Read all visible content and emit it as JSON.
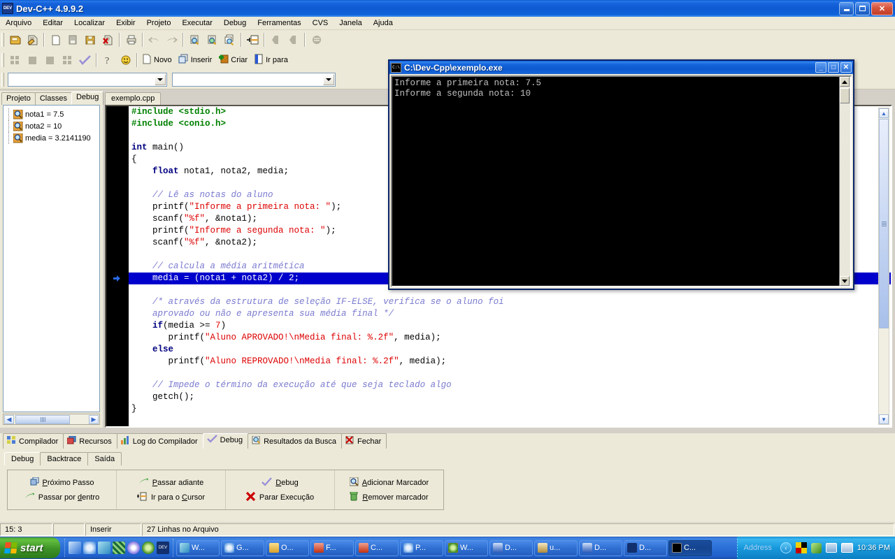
{
  "window": {
    "title": "Dev-C++ 4.9.9.2",
    "icon": "dev-cpp-icon",
    "buttons": {
      "minimize": "minimize-button",
      "restore": "restore-button",
      "close": "close-button"
    }
  },
  "menubar": {
    "items": [
      "Arquivo",
      "Editar",
      "Localizar",
      "Exibir",
      "Projeto",
      "Executar",
      "Debug",
      "Ferramentas",
      "CVS",
      "Janela",
      "Ajuda"
    ]
  },
  "toolbar": {
    "row1_icons": [
      "open-project-icon",
      "open-file-icon",
      "new-file-icon",
      "save-file-icon",
      "save-all-icon",
      "close-file-icon",
      "print-icon",
      "undo-icon",
      "redo-icon",
      "find-icon",
      "find-next-icon",
      "replace-icon",
      "goto-line-icon",
      "back-icon",
      "forward-icon",
      "list-icon"
    ],
    "row2_icons": [
      "compile-icon",
      "run-icon",
      "stop-icon",
      "compile-and-run-icon",
      "rebuild-all-icon",
      "help-icon",
      "about-icon"
    ],
    "row2_buttons": [
      {
        "label": "Novo",
        "icon": "new-page-icon"
      },
      {
        "label": "Inserir",
        "icon": "insert-icon"
      },
      {
        "label": "Criar",
        "icon": "create-icon"
      },
      {
        "label": "Ir para",
        "icon": "goto-icon"
      }
    ],
    "combo_left_value": "",
    "combo_right_value": ""
  },
  "left_panel": {
    "tabs": [
      {
        "label": "Projeto",
        "active": false
      },
      {
        "label": "Classes",
        "active": false
      },
      {
        "label": "Debug",
        "active": true
      }
    ],
    "watches": [
      {
        "icon": "watch-icon",
        "text": "nota1 = 7.5"
      },
      {
        "icon": "watch-icon",
        "text": "nota2 = 10"
      },
      {
        "icon": "watch-icon",
        "text": "media = 3.2141190"
      }
    ],
    "hscroll": {
      "left": "◀",
      "right": "▶"
    }
  },
  "editor": {
    "tab": "exemplo.cpp",
    "active_line_index": 14,
    "breakpoint_marker": "current-line-arrow",
    "lines": [
      [
        {
          "t": "#include ",
          "c": "pre"
        },
        {
          "t": "<stdio.h>",
          "c": "pre"
        }
      ],
      [
        {
          "t": "#include ",
          "c": "pre"
        },
        {
          "t": "<conio.h>",
          "c": "pre"
        }
      ],
      [
        {
          "t": "",
          "c": "id"
        }
      ],
      [
        {
          "t": "int",
          "c": "kw"
        },
        {
          "t": " main()",
          "c": "id"
        }
      ],
      [
        {
          "t": "{",
          "c": "id"
        }
      ],
      [
        {
          "t": "    ",
          "c": "id"
        },
        {
          "t": "float",
          "c": "kw"
        },
        {
          "t": " nota1, nota2, media;",
          "c": "id"
        }
      ],
      [
        {
          "t": "",
          "c": "id"
        }
      ],
      [
        {
          "t": "    ",
          "c": "id"
        },
        {
          "t": "// Lê as notas do aluno",
          "c": "cmt"
        }
      ],
      [
        {
          "t": "    printf(",
          "c": "id"
        },
        {
          "t": "\"Informe a primeira nota: \"",
          "c": "str"
        },
        {
          "t": ");",
          "c": "id"
        }
      ],
      [
        {
          "t": "    scanf(",
          "c": "id"
        },
        {
          "t": "\"%f\"",
          "c": "str"
        },
        {
          "t": ", &nota1);",
          "c": "id"
        }
      ],
      [
        {
          "t": "    printf(",
          "c": "id"
        },
        {
          "t": "\"Informe a segunda nota: \"",
          "c": "str"
        },
        {
          "t": ");",
          "c": "id"
        }
      ],
      [
        {
          "t": "    scanf(",
          "c": "id"
        },
        {
          "t": "\"%f\"",
          "c": "str"
        },
        {
          "t": ", &nota2);",
          "c": "id"
        }
      ],
      [
        {
          "t": "",
          "c": "id"
        }
      ],
      [
        {
          "t": "    ",
          "c": "id"
        },
        {
          "t": "// calcula a média aritmética",
          "c": "cmt"
        }
      ],
      [
        {
          "t": "    media = (nota1 + nota2) / ",
          "c": "id"
        },
        {
          "t": "2",
          "c": "num"
        },
        {
          "t": ";",
          "c": "id"
        }
      ],
      [
        {
          "t": "",
          "c": "id"
        }
      ],
      [
        {
          "t": "    ",
          "c": "id"
        },
        {
          "t": "/* através da estrutura de seleção IF-ELSE, verifica se o aluno foi",
          "c": "cmt"
        }
      ],
      [
        {
          "t": "    ",
          "c": "cmt"
        },
        {
          "t": "aprovado ou não e apresenta sua média final */",
          "c": "cmt"
        }
      ],
      [
        {
          "t": "    ",
          "c": "id"
        },
        {
          "t": "if",
          "c": "kw"
        },
        {
          "t": "(media >= ",
          "c": "id"
        },
        {
          "t": "7",
          "c": "num"
        },
        {
          "t": ")",
          "c": "id"
        }
      ],
      [
        {
          "t": "       printf(",
          "c": "id"
        },
        {
          "t": "\"Aluno APROVADO!\\nMedia final: %.2f\"",
          "c": "str"
        },
        {
          "t": ", media);",
          "c": "id"
        }
      ],
      [
        {
          "t": "    ",
          "c": "id"
        },
        {
          "t": "else",
          "c": "kw"
        }
      ],
      [
        {
          "t": "       printf(",
          "c": "id"
        },
        {
          "t": "\"Aluno REPROVADO!\\nMedia final: %.2f\"",
          "c": "str"
        },
        {
          "t": ", media);",
          "c": "id"
        }
      ],
      [
        {
          "t": "",
          "c": "id"
        }
      ],
      [
        {
          "t": "    ",
          "c": "id"
        },
        {
          "t": "// Impede o término da execução até que seja teclado algo",
          "c": "cmt"
        }
      ],
      [
        {
          "t": "    getch();",
          "c": "id"
        }
      ],
      [
        {
          "t": "}",
          "c": "id"
        }
      ]
    ]
  },
  "console": {
    "title": "C:\\Dev-Cpp\\exemplo.exe",
    "icon": "console-icon",
    "buttons": {
      "minimize": "_",
      "maximize": "□",
      "close": "✕"
    },
    "output": [
      "Informe a primeira nota: 7.5",
      "Informe a segunda nota: 10"
    ]
  },
  "bottom_panel": {
    "tabs": [
      {
        "label": "Compilador",
        "icon": "compiler-icon",
        "active": false
      },
      {
        "label": "Recursos",
        "icon": "resources-icon",
        "active": false
      },
      {
        "label": "Log do Compilador",
        "icon": "log-icon",
        "active": false
      },
      {
        "label": "Debug",
        "icon": "debug-check-icon",
        "active": true
      },
      {
        "label": "Resultados da Busca",
        "icon": "search-results-icon",
        "active": false
      },
      {
        "label": "Fechar",
        "icon": "close-red-icon",
        "active": false
      }
    ],
    "subtabs": [
      {
        "label": "Debug",
        "active": true
      },
      {
        "label": "Backtrace",
        "active": false
      },
      {
        "label": "Saída",
        "active": false
      }
    ],
    "buttons": [
      [
        {
          "label": "Próximo Passo",
          "icon": "next-step-icon",
          "accel": "P"
        },
        {
          "label": "Passar por dentro",
          "icon": "step-into-icon",
          "accel": "d"
        }
      ],
      [
        {
          "label": "Passar adiante",
          "icon": "step-over-icon",
          "accel": "P"
        },
        {
          "label": "Ir para o Cursor",
          "icon": "run-to-cursor-icon",
          "accel": "C"
        }
      ],
      [
        {
          "label": "Debug",
          "icon": "debug-check-icon",
          "accel": "D"
        },
        {
          "label": "Parar Execução",
          "icon": "stop-red-icon",
          "accel": ""
        }
      ],
      [
        {
          "label": "Adicionar Marcador",
          "icon": "add-watch-icon",
          "accel": "A"
        },
        {
          "label": "Remover marcador",
          "icon": "remove-watch-icon",
          "accel": "R"
        }
      ]
    ]
  },
  "statusbar": {
    "cells": [
      "15: 3",
      "",
      "Inserir",
      "27 Linhas no Arquivo"
    ]
  },
  "taskbar": {
    "start_label": "start",
    "quicklaunch": [
      "show-desktop-icon",
      "internet-explorer-icon",
      "messenger-icon",
      "media-icon",
      "cd-icon",
      "player-icon",
      "devcpp-icon"
    ],
    "tasks": [
      {
        "label": "W...",
        "icon": "messenger-icon",
        "active": false
      },
      {
        "label": "G...",
        "icon": "ie-icon",
        "active": false
      },
      {
        "label": "O...",
        "icon": "folder-icon",
        "active": false
      },
      {
        "label": "F...",
        "icon": "powerpoint-icon",
        "active": false
      },
      {
        "label": "C...",
        "icon": "powerpoint-icon",
        "active": false
      },
      {
        "label": "P...",
        "icon": "ie-icon",
        "active": false
      },
      {
        "label": "W...",
        "icon": "mediaplayer-icon",
        "active": false
      },
      {
        "label": "D...",
        "icon": "word-icon",
        "active": false
      },
      {
        "label": "u...",
        "icon": "paint-icon",
        "active": false
      },
      {
        "label": "D...",
        "icon": "word-icon",
        "active": false
      },
      {
        "label": "D...",
        "icon": "devcpp-icon",
        "active": false
      },
      {
        "label": "C...",
        "icon": "console-icon",
        "active": true
      }
    ],
    "address_label": "Address",
    "tray_icons": [
      "chevron-left-icon",
      "colors-icon",
      "messenger-green-icon",
      "network-icon",
      "monitor-icon"
    ],
    "clock": "10:36 PM"
  },
  "colors": {
    "title_blue": "#0d5bd4",
    "face": "#ece9d8",
    "highlight_line": "#0000cc",
    "comment": "#7a7ad0",
    "string": "#dd0000",
    "keyword": "#000080",
    "preprocessor": "#008000"
  }
}
